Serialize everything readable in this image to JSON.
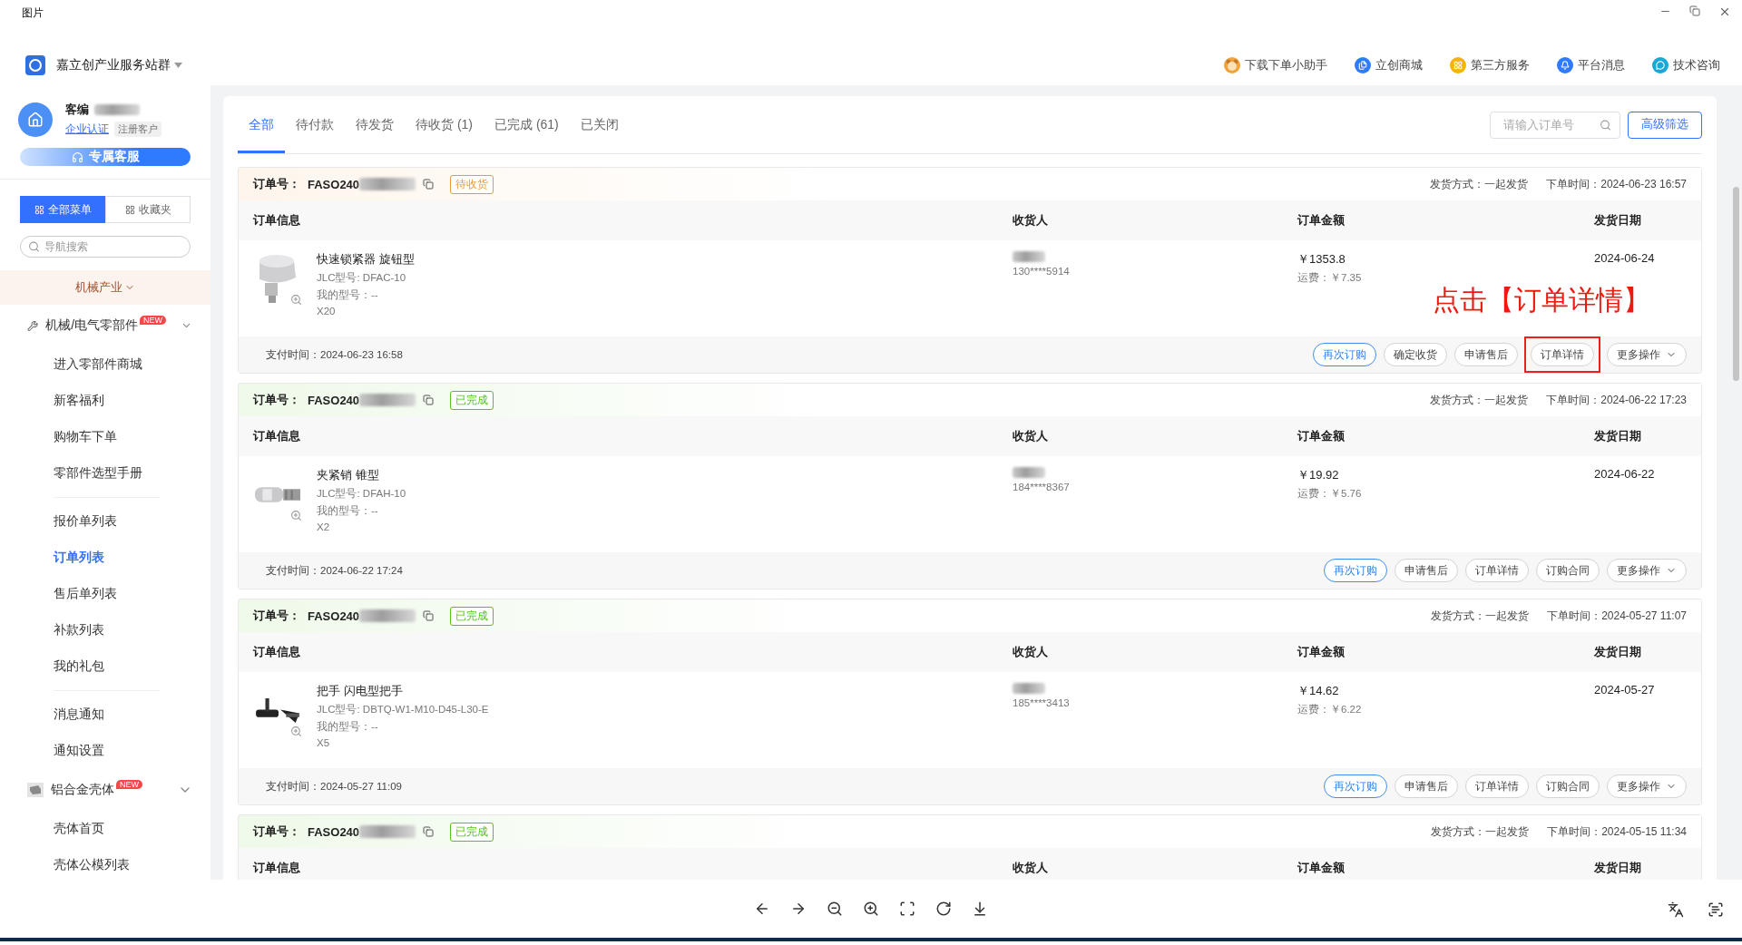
{
  "viewer": {
    "title": "图片"
  },
  "header": {
    "site": "嘉立创产业服务站群",
    "links": [
      "下载下单小助手",
      "立创商城",
      "第三方服务",
      "平台消息",
      "技术咨询"
    ]
  },
  "user": {
    "name": "客编",
    "verify_link": "企业认证",
    "tag": "注册客户"
  },
  "service_button": "专属客服",
  "menu_tabs": [
    {
      "label": "全部菜单",
      "selected": true
    },
    {
      "label": "收藏夹",
      "selected": false
    }
  ],
  "nav_search": {
    "placeholder": "导航搜索"
  },
  "industry": "机械产业",
  "nav_groups": [
    {
      "label": "机械/电气零部件",
      "badge": "NEW",
      "expanded": true,
      "sections": [
        [
          {
            "label": "进入零部件商城",
            "selected": false
          },
          {
            "label": "新客福利",
            "selected": false
          },
          {
            "label": "购物车下单",
            "selected": false
          },
          {
            "label": "零部件选型手册",
            "selected": false
          }
        ],
        [
          {
            "label": "报价单列表",
            "selected": false
          },
          {
            "label": "订单列表",
            "selected": true
          },
          {
            "label": "售后单列表",
            "selected": false
          },
          {
            "label": "补款列表",
            "selected": false
          },
          {
            "label": "我的礼包",
            "selected": false
          }
        ],
        [
          {
            "label": "消息通知",
            "selected": false
          },
          {
            "label": "通知设置",
            "selected": false
          }
        ]
      ]
    },
    {
      "label": "铝合金壳体",
      "badge": "NEW",
      "expanded": true,
      "sections": [
        [
          {
            "label": "壳体首页",
            "selected": false
          },
          {
            "label": "壳体公模列表",
            "selected": false
          }
        ]
      ]
    }
  ],
  "order_tabs": [
    {
      "label": "全部",
      "selected": true
    },
    {
      "label": "待付款",
      "selected": false
    },
    {
      "label": "待发货",
      "selected": false
    },
    {
      "label": "待收货 (1)",
      "selected": false
    },
    {
      "label": "已完成 (61)",
      "selected": false
    },
    {
      "label": "已关闭",
      "selected": false
    }
  ],
  "order_search": {
    "placeholder": "请输入订单号"
  },
  "filter_button": "高级筛选",
  "annotation": {
    "text": "点击【订单详情】"
  },
  "orders": [
    {
      "number_label": "订单号：",
      "number": "FASO240",
      "status": "待收货",
      "color": "#f09a36",
      "ship_method": "发货方式：一起发货",
      "order_time": "下单时间：2024-06-23 16:57",
      "columns": [
        "订单信息",
        "收货人",
        "订单金额",
        "发货日期"
      ],
      "item": {
        "name": "快速锁紧器 旋钮型",
        "jlc_model": "JLC型号: DFAC-10",
        "my_model": "我的型号：--",
        "quantity": "X20"
      },
      "phone": "130****5914",
      "amount": "￥1353.8",
      "freight": "运费：￥7.35",
      "ship_date": "2024-06-24",
      "paid_time": "支付时间：2024-06-23 16:58",
      "actions": [
        {
          "label": "再次订购",
          "primary": true,
          "highlighted": false
        },
        {
          "label": "确定收货",
          "primary": false,
          "highlighted": false
        },
        {
          "label": "申请售后",
          "primary": false,
          "highlighted": false
        },
        {
          "label": "订单详情",
          "primary": false,
          "highlighted": true
        },
        {
          "label": "更多操作",
          "primary": false,
          "highlighted": false,
          "dropdown": true
        }
      ]
    },
    {
      "number_label": "订单号：",
      "number": "FASO240",
      "status": "已完成",
      "color": "#52c41a",
      "ship_method": "发货方式：一起发货",
      "order_time": "下单时间：2024-06-22 17:23",
      "columns": [
        "订单信息",
        "收货人",
        "订单金额",
        "发货日期"
      ],
      "item": {
        "name": "夹紧销 锥型",
        "jlc_model": "JLC型号: DFAH-10",
        "my_model": "我的型号：--",
        "quantity": "X2"
      },
      "phone": "184****8367",
      "amount": "￥19.92",
      "freight": "运费：￥5.76",
      "ship_date": "2024-06-22",
      "paid_time": "支付时间：2024-06-22 17:24",
      "actions": [
        {
          "label": "再次订购",
          "primary": true,
          "highlighted": false
        },
        {
          "label": "申请售后",
          "primary": false,
          "highlighted": false
        },
        {
          "label": "订单详情",
          "primary": false,
          "highlighted": false
        },
        {
          "label": "订购合同",
          "primary": false,
          "highlighted": false
        },
        {
          "label": "更多操作",
          "primary": false,
          "highlighted": false,
          "dropdown": true
        }
      ]
    },
    {
      "number_label": "订单号：",
      "number": "FASO240",
      "status": "已完成",
      "color": "#52c41a",
      "ship_method": "发货方式：一起发货",
      "order_time": "下单时间：2024-05-27 11:07",
      "columns": [
        "订单信息",
        "收货人",
        "订单金额",
        "发货日期"
      ],
      "item": {
        "name": "把手 闪电型把手",
        "jlc_model": "JLC型号: DBTQ-W1-M10-D45-L30-E",
        "my_model": "我的型号：--",
        "quantity": "X5"
      },
      "phone": "185****3413",
      "amount": "￥14.62",
      "freight": "运费：￥6.22",
      "ship_date": "2024-05-27",
      "paid_time": "支付时间：2024-05-27 11:09",
      "actions": [
        {
          "label": "再次订购",
          "primary": true,
          "highlighted": false
        },
        {
          "label": "申请售后",
          "primary": false,
          "highlighted": false
        },
        {
          "label": "订单详情",
          "primary": false,
          "highlighted": false
        },
        {
          "label": "订购合同",
          "primary": false,
          "highlighted": false
        },
        {
          "label": "更多操作",
          "primary": false,
          "highlighted": false,
          "dropdown": true
        }
      ]
    },
    {
      "number_label": "订单号：",
      "number": "FASO240",
      "status": "已完成",
      "color": "#52c41a",
      "ship_method": "发货方式：一起发货",
      "order_time": "下单时间：2024-05-15 11:34",
      "columns": [
        "订单信息",
        "收货人",
        "订单金额",
        "发货日期"
      ]
    }
  ]
}
